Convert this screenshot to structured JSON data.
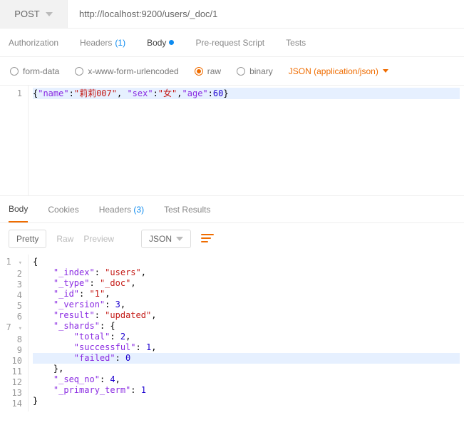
{
  "request": {
    "method": "POST",
    "url": "http://localhost:9200/users/_doc/1"
  },
  "tabs": {
    "authorization": "Authorization",
    "headers": "Headers",
    "headers_count": "(1)",
    "body": "Body",
    "prerequest": "Pre-request Script",
    "tests": "Tests"
  },
  "body_types": {
    "formdata": "form-data",
    "xwww": "x-www-form-urlencoded",
    "raw": "raw",
    "binary": "binary",
    "json_label": "JSON (application/json)"
  },
  "request_body_line": "{\"name\":\"莉莉007\", \"sex\":\"女\",\"age\":60}",
  "request_body": {
    "name": "莉莉007",
    "sex": "女",
    "age": 60
  },
  "response_tabs": {
    "body": "Body",
    "cookies": "Cookies",
    "headers": "Headers",
    "headers_count": "(3)",
    "tests": "Test Results"
  },
  "format": {
    "pretty": "Pretty",
    "raw": "Raw",
    "preview": "Preview",
    "type": "JSON"
  },
  "response_json": {
    "_index": "users",
    "_type": "_doc",
    "_id": "1",
    "_version": 3,
    "result": "updated",
    "_shards": {
      "total": 2,
      "successful": 1,
      "failed": 0
    },
    "_seq_no": 4,
    "_primary_term": 1
  },
  "line_numbers": {
    "req": "1",
    "resp": [
      "1",
      "2",
      "3",
      "4",
      "5",
      "6",
      "7",
      "8",
      "9",
      "10",
      "11",
      "12",
      "13",
      "14"
    ]
  }
}
